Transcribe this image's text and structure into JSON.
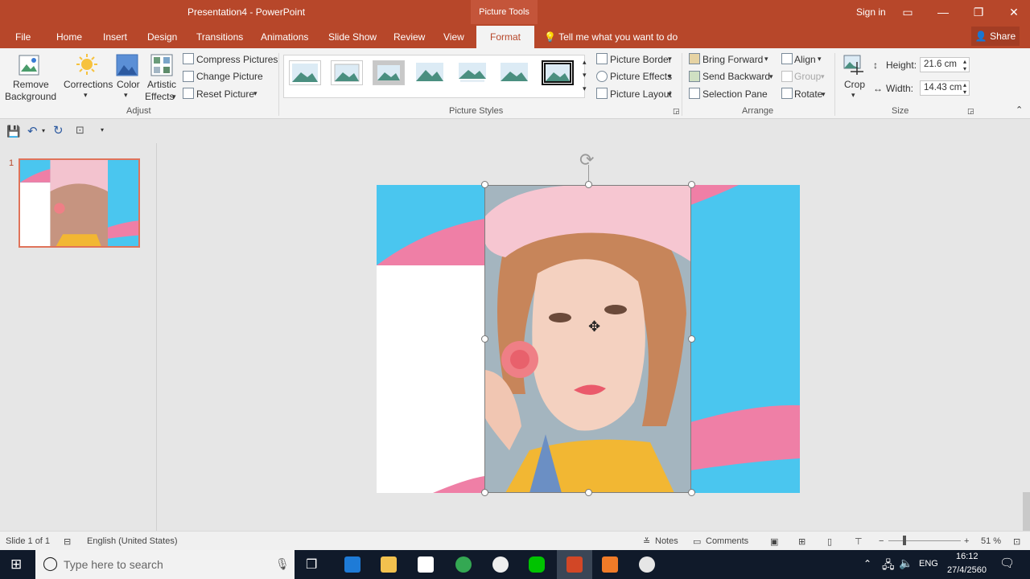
{
  "window": {
    "title": "Presentation4 - PowerPoint",
    "context_tab_group": "Picture Tools",
    "sign_in": "Sign in",
    "minimize": "—",
    "restore": "❐",
    "close": "✕"
  },
  "tabs": [
    "File",
    "Home",
    "Insert",
    "Design",
    "Transitions",
    "Animations",
    "Slide Show",
    "Review",
    "View",
    "Format"
  ],
  "active_tab": "Format",
  "tell_me": "Tell me what you want to do",
  "share": "Share",
  "ribbon": {
    "adjust": {
      "remove_background_1": "Remove",
      "remove_background_2": "Background",
      "corrections": "Corrections",
      "color": "Color",
      "artistic_1": "Artistic",
      "artistic_2": "Effects",
      "compress": "Compress Pictures",
      "change": "Change Picture",
      "reset": "Reset Picture",
      "group_label": "Adjust"
    },
    "picture_styles": {
      "group_label": "Picture Styles",
      "border": "Picture Border",
      "effects": "Picture Effects",
      "layout": "Picture Layout"
    },
    "arrange": {
      "bring_forward": "Bring Forward",
      "send_backward": "Send Backward",
      "selection_pane": "Selection Pane",
      "align": "Align",
      "group": "Group",
      "rotate": "Rotate",
      "group_label": "Arrange"
    },
    "size": {
      "crop": "Crop",
      "height_label": "Height:",
      "height_value": "21.6 cm",
      "width_label": "Width:",
      "width_value": "14.43 cm",
      "group_label": "Size"
    }
  },
  "thumbnails": [
    {
      "number": "1"
    }
  ],
  "status": {
    "slide": "Slide 1 of 1",
    "language": "English (United States)",
    "notes": "Notes",
    "comments": "Comments",
    "zoom": "51 %"
  },
  "taskbar": {
    "search_placeholder": "Type here to search",
    "lang": "ENG",
    "time": "16:12",
    "date": "27/4/2560"
  },
  "colors": {
    "accent": "#b7472a",
    "slide_blue": "#4ac6ef",
    "slide_pink": "#ef7fa6"
  }
}
